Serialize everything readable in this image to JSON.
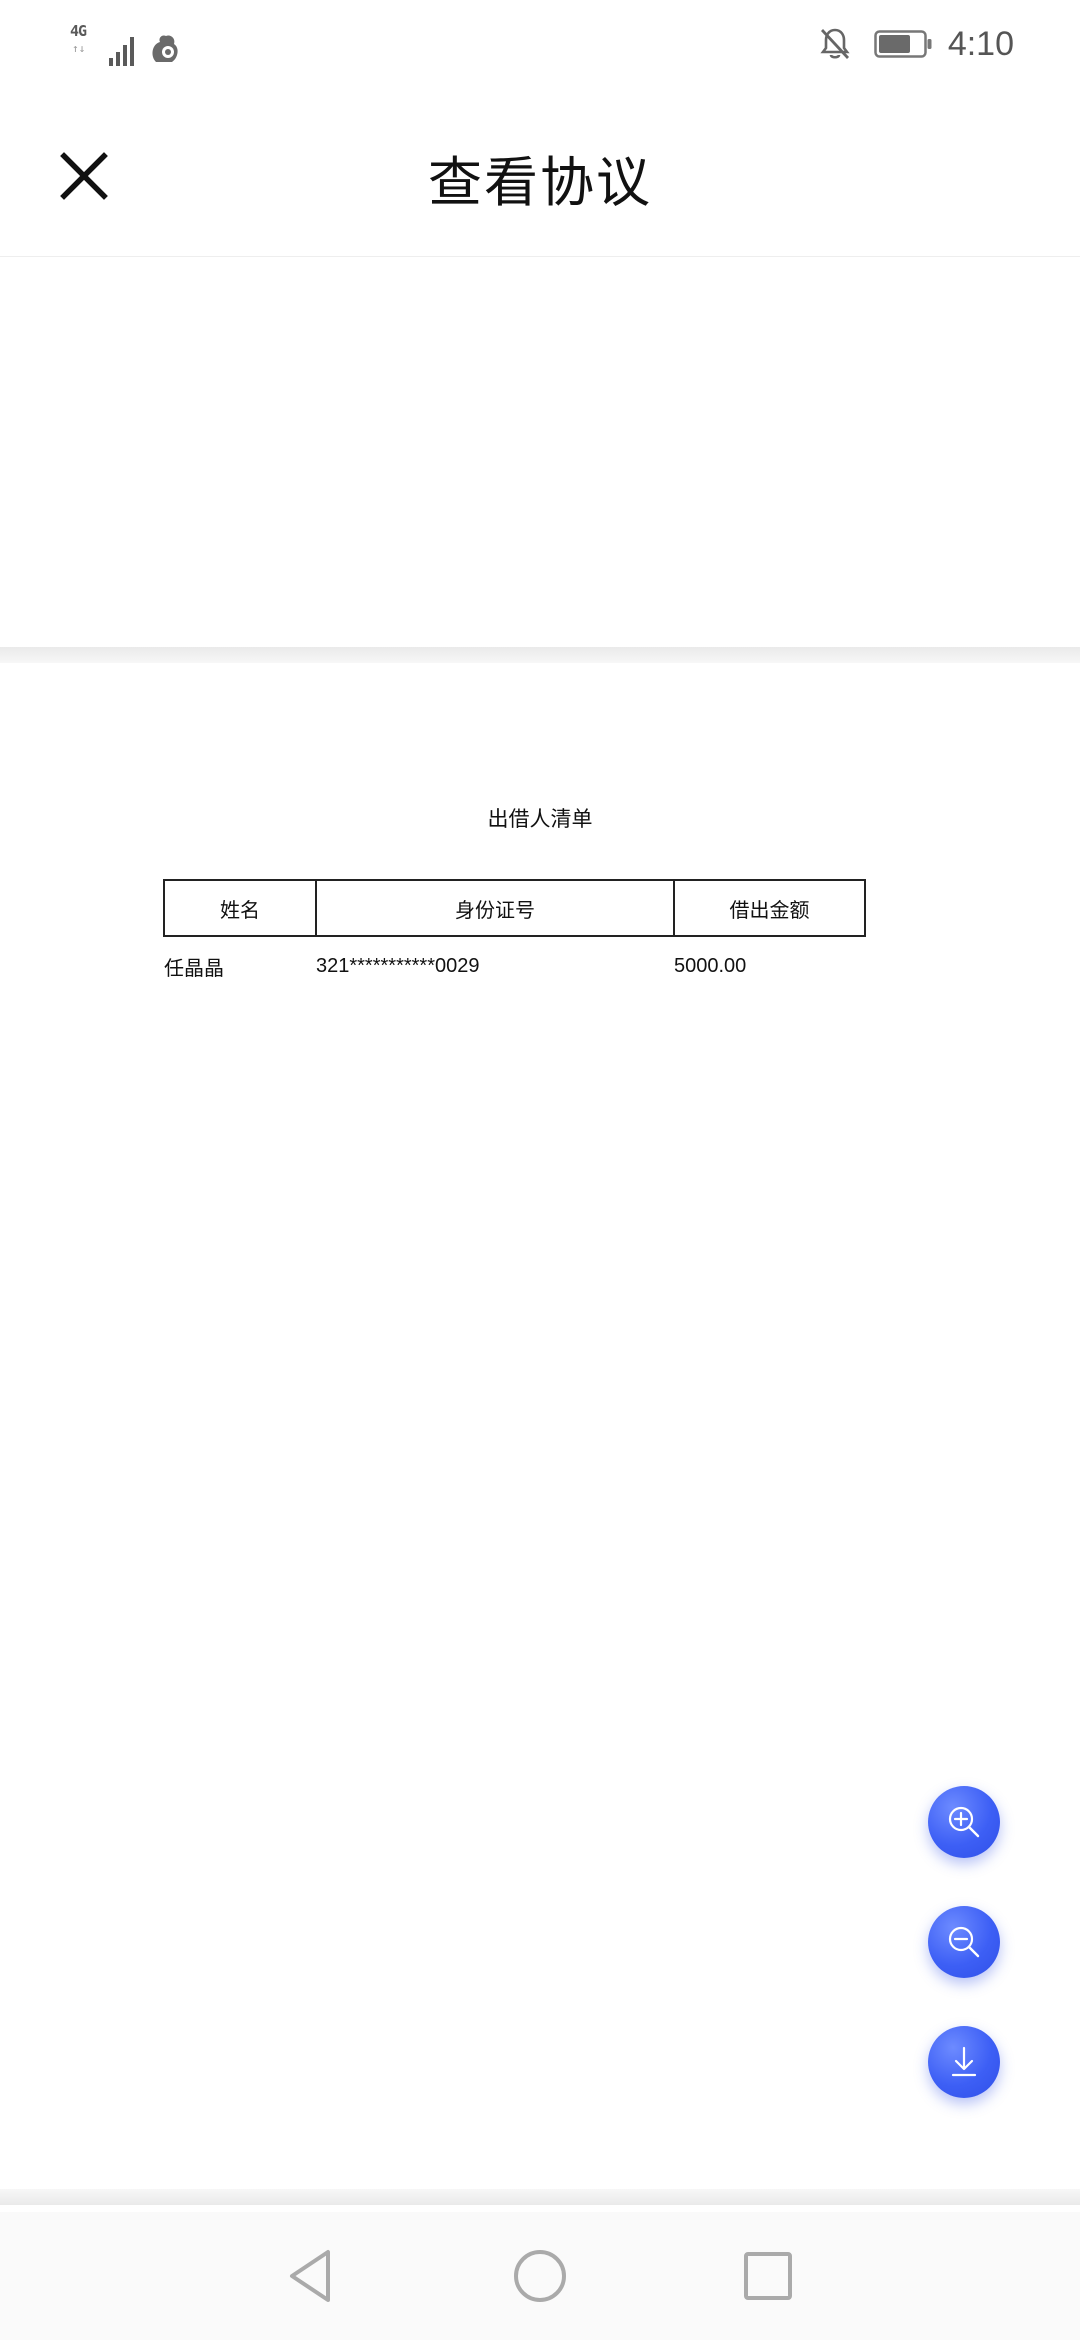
{
  "status_bar": {
    "network_type": "4G",
    "network_sub": "↑↓",
    "time": "4:10",
    "icons": [
      "signal-icon",
      "squirrel-app-icon",
      "bell-off-icon",
      "battery-icon"
    ]
  },
  "header": {
    "title": "查看协议",
    "close_icon": "close-icon"
  },
  "document": {
    "title": "出借人清单",
    "table": {
      "headers": [
        "姓名",
        "身份证号",
        "借出金额"
      ],
      "rows": [
        [
          "任晶晶",
          "321***********0029",
          "5000.00"
        ]
      ]
    }
  },
  "fabs": {
    "zoom_in": "zoom-in-icon",
    "zoom_out": "zoom-out-icon",
    "download": "download-icon"
  },
  "nav_bar": {
    "back": "back-triangle-icon",
    "home": "home-circle-icon",
    "recent": "recent-square-icon"
  },
  "colors": {
    "fab_blue": "#3d5ff5",
    "nav_icon_gray": "#aaaaaa"
  }
}
